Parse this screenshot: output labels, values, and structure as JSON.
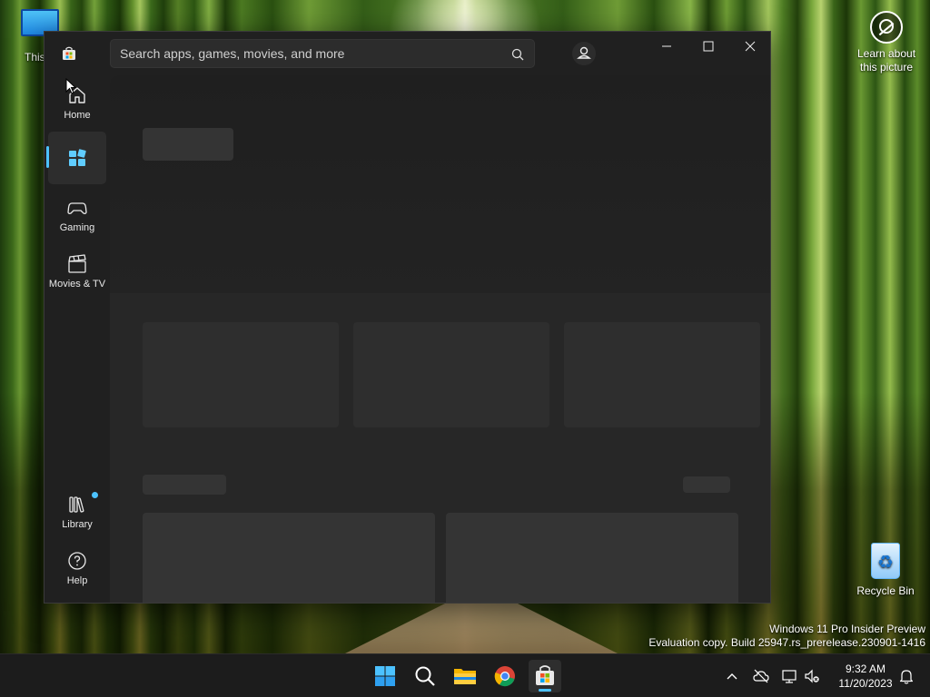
{
  "desktop": {
    "this_pc_label": "This P",
    "learn_label": "Learn about this picture",
    "recycle_label": "Recycle Bin",
    "watermark_line1": "Windows 11 Pro Insider Preview",
    "watermark_line2": "Evaluation copy. Build 25947.rs_prerelease.230901-1416"
  },
  "window": {
    "search_placeholder": "Search apps, games, movies, and more"
  },
  "nav": {
    "items": [
      {
        "label": "Home",
        "icon": "home-icon"
      },
      {
        "label": "",
        "icon": "apps-icon"
      },
      {
        "label": "Gaming",
        "icon": "gamepad-icon"
      },
      {
        "label": "Movies & TV",
        "icon": "clapperboard-icon"
      }
    ],
    "library": {
      "label": "Library",
      "icon": "library-icon"
    },
    "help": {
      "label": "Help",
      "icon": "help-icon"
    }
  },
  "taskbar": {
    "time": "9:32 AM",
    "date": "11/20/2023",
    "apps": [
      "start-icon",
      "search-icon",
      "file-explorer-icon",
      "chrome-icon",
      "store-icon"
    ]
  },
  "colors": {
    "accent": "#4cc2ff",
    "window_bg": "#202020",
    "content_bg": "#272727",
    "taskbar_bg": "#1c1c1c"
  }
}
